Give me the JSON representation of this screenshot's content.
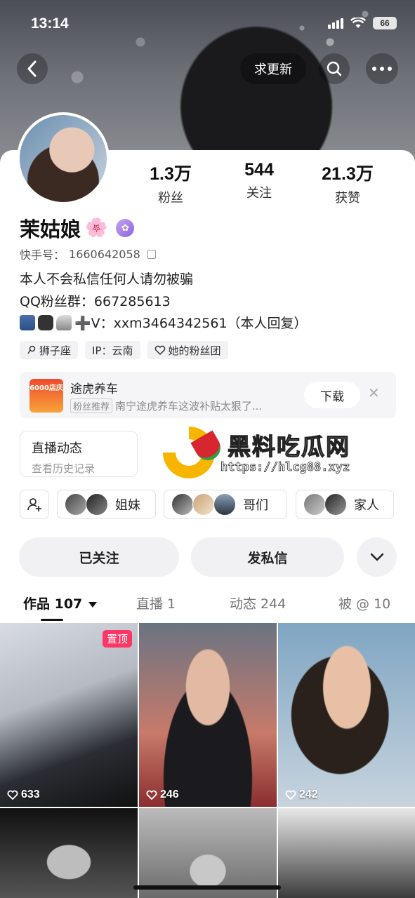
{
  "status_bar": {
    "time": "13:14",
    "battery": "66"
  },
  "nav": {
    "update_label": "求更新"
  },
  "profile": {
    "stats": [
      {
        "value": "1.3万",
        "label": "粉丝"
      },
      {
        "value": "544",
        "label": "关注"
      },
      {
        "value": "21.3万",
        "label": "获赞"
      }
    ],
    "name": "茉姑娘",
    "name_emoji": "🌸",
    "id_label": "快手号：",
    "id_value": "1660642058",
    "bio_line1": "本人不会私信任何人请勿被骗",
    "bio_line2": "QQ粉丝群：667285613",
    "bio_line3_text": "➕V：xxm3464342561（本人回复）",
    "tags": [
      "狮子座",
      "IP：云南",
      "她的粉丝团"
    ]
  },
  "ad": {
    "logo_text": "6000店庆",
    "title": "途虎养车",
    "chip": "粉丝推荐",
    "subtitle": "南宁途虎养车这波补贴太狠了...",
    "button": "下载"
  },
  "live": {
    "title": "直播动态",
    "subtitle": "查看历史记录"
  },
  "watermark": {
    "title": "黑料吃瓜网",
    "url": "https://hlcg88.xyz"
  },
  "groups": [
    {
      "label": "姐妹"
    },
    {
      "label": "哥们"
    },
    {
      "label": "家人"
    }
  ],
  "actions": {
    "follow": "已关注",
    "message": "发私信"
  },
  "tabs": [
    {
      "label": "作品 107"
    },
    {
      "label": "直播 1"
    },
    {
      "label": "动态 244"
    },
    {
      "label": "被 @ 10"
    }
  ],
  "grid": {
    "pin_label": "置顶",
    "items": [
      {
        "likes": "633"
      },
      {
        "likes": "246"
      },
      {
        "likes": "242"
      }
    ]
  }
}
